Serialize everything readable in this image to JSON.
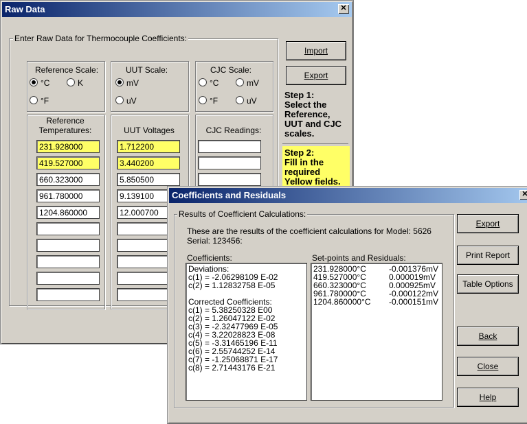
{
  "raw_window": {
    "title": "Raw Data",
    "close_glyph": "✕",
    "group_label": "Enter Raw Data for Thermocouple Coefficients:",
    "reference_scale": {
      "label": "Reference Scale:",
      "options": [
        "°C",
        "K",
        "°F"
      ],
      "selected": "°C"
    },
    "uut_scale": {
      "label": "UUT Scale:",
      "options": [
        "mV",
        "uV"
      ],
      "selected": "mV"
    },
    "cjc_scale": {
      "label": "CJC Scale:",
      "options": [
        "°C",
        "mV",
        "°F",
        "uV"
      ]
    },
    "col_headers": {
      "reference": "Reference\nTemperatures:",
      "uut": "UUT Voltages",
      "cjc": "CJC Readings:"
    },
    "reference_temps": [
      "231.928000",
      "419.527000",
      "660.323000",
      "961.780000",
      "1204.860000",
      "",
      "",
      "",
      "",
      ""
    ],
    "uut_voltages": [
      "1.712200",
      "3.440200",
      "5.850500",
      "9.139100",
      "12.000700"
    ],
    "import_label": "Import",
    "export_label": "Export",
    "step1": "Step 1:\nSelect the\nReference,\nUUT and CJC\nscales.",
    "step2": "Step 2:\nFill in the\nrequired\nYellow fields."
  },
  "coef_window": {
    "title": "Coefficients and Residuals",
    "close_glyph": "✕",
    "group_label": "Results of Coefficient Calculations:",
    "intro_line1": "These are the results of the coefficient calculations for Model: 5626",
    "intro_line2": "Serial: 123456:",
    "coefficients_label": "Coefficients:",
    "setpoints_label": "Set-points and Residuals:",
    "coefficients_lines": [
      "Deviations:",
      "c(1) = -2.06298109 E-02",
      "c(2) = 1.12832758 E-05",
      "",
      "Corrected Coefficients:",
      "c(1) = 5.38250328 E00",
      "c(2) = 1.26047122 E-02",
      "c(3) = -2.32477969 E-05",
      "c(4) = 3.22028823 E-08",
      "c(5) = -3.31465196 E-11",
      "c(6) = 2.55744252 E-14",
      "c(7) = -1.25068871 E-17",
      "c(8) = 2.71443176 E-21"
    ],
    "setpoints": [
      {
        "temp": "231.928000°C",
        "residual": "-0.001376mV"
      },
      {
        "temp": "419.527000°C",
        "residual": "0.000019mV"
      },
      {
        "temp": "660.323000°C",
        "residual": "0.000925mV"
      },
      {
        "temp": "961.780000°C",
        "residual": "-0.000122mV"
      },
      {
        "temp": "1204.860000°C",
        "residual": "-0.000151mV"
      }
    ],
    "buttons": {
      "export": "Export",
      "print_report": "Print Report",
      "table_options": "Table Options",
      "back": "Back",
      "close": "Close",
      "help": "Help"
    }
  },
  "colors": {
    "title_bar": "#0a246a",
    "highlight": "#ffff66",
    "face": "#d4d0c8"
  }
}
